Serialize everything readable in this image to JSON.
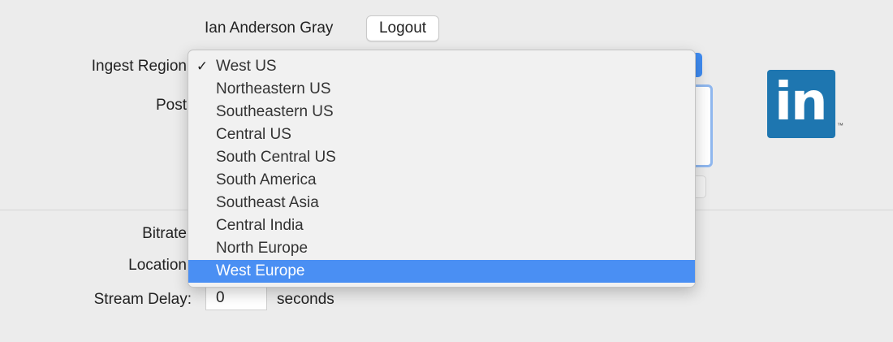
{
  "header": {
    "user_name": "Ian Anderson Gray",
    "logout_label": "Logout"
  },
  "form": {
    "ingest_region_label": "Ingest Region",
    "post_label": "Post",
    "bitrate_label": "Bitrate",
    "location_label": "Location",
    "stream_delay_label": "Stream Delay:",
    "stream_delay_value": "0",
    "stream_delay_unit": "seconds"
  },
  "dropdown": {
    "selected_value": "West US",
    "highlighted": "West Europe",
    "options": [
      {
        "label": "West US",
        "checked": true
      },
      {
        "label": "Northeastern US",
        "checked": false
      },
      {
        "label": "Southeastern US",
        "checked": false
      },
      {
        "label": "Central US",
        "checked": false
      },
      {
        "label": "South Central US",
        "checked": false
      },
      {
        "label": "South America",
        "checked": false
      },
      {
        "label": "Southeast Asia",
        "checked": false
      },
      {
        "label": "Central India",
        "checked": false
      },
      {
        "label": "North Europe",
        "checked": false
      },
      {
        "label": "West Europe",
        "checked": false
      }
    ],
    "check_glyph": "✓"
  },
  "brand": {
    "logo_text": "in",
    "trademark": "™",
    "color": "#1e76b0"
  },
  "colors": {
    "highlight": "#4a8ff3",
    "background": "#ececec"
  }
}
